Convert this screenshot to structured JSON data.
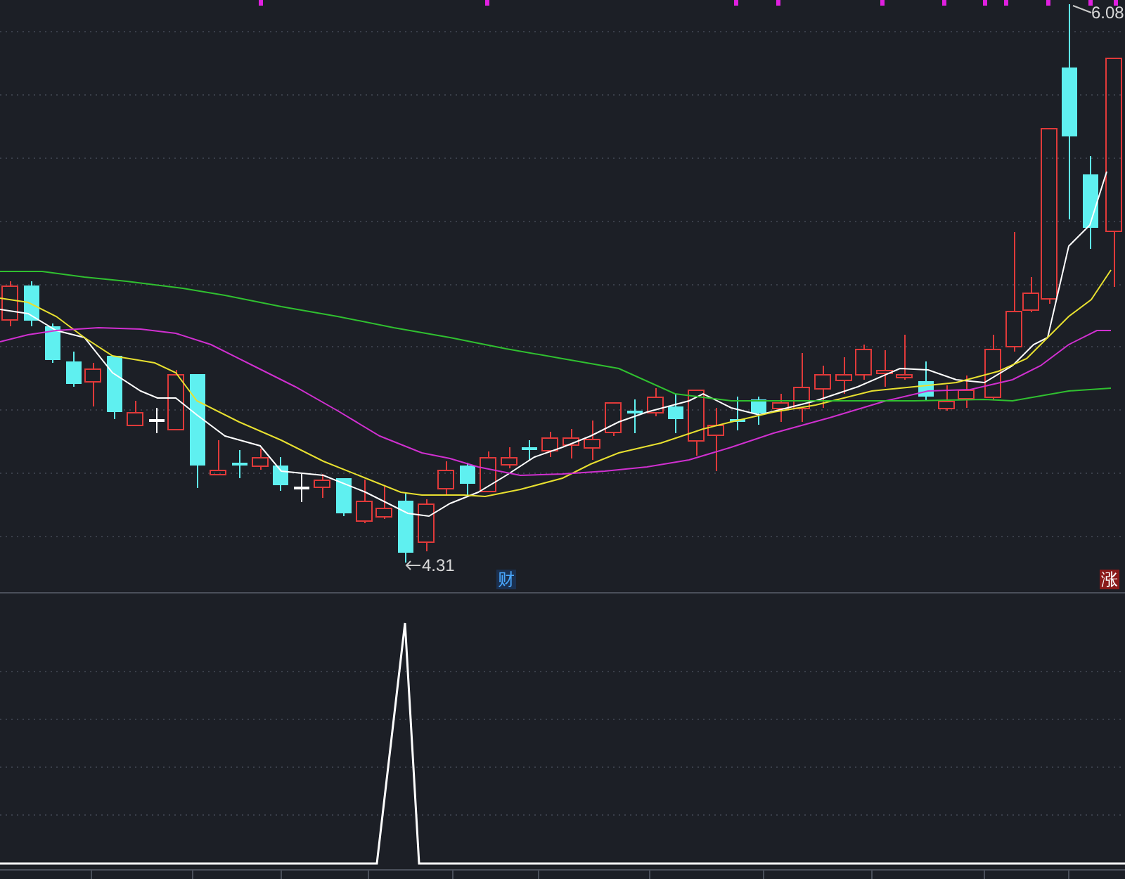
{
  "price_chart": {
    "high_label": "6.08",
    "low_label": "4.31",
    "markers": [
      {
        "text": "财",
        "kind": "finance"
      },
      {
        "text": "涨",
        "kind": "limit-up"
      }
    ]
  }
}
